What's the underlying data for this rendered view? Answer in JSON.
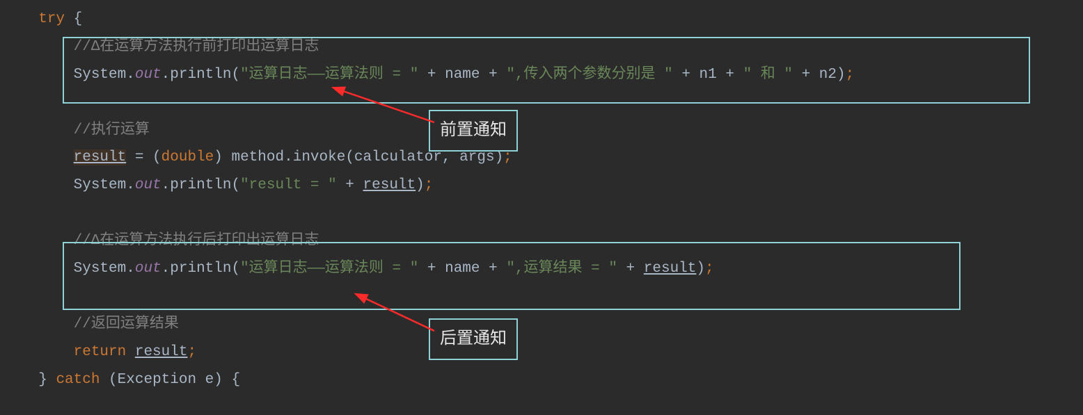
{
  "annotations": {
    "label1": "前置通知",
    "label2": "后置通知"
  },
  "code": {
    "l1_try": "try",
    "l1_brace": " {",
    "l2_comment": "//Δ在运算方法执行前打印出运算日志",
    "l3_sys": "System.",
    "l3_out": "out",
    "l3_println": ".println(",
    "l3_str1": "\"运算日志——运算法则 = \"",
    "l3_plus1": " + name + ",
    "l3_str2": "\",传入两个参数分别是 \"",
    "l3_plus2": " + n1 + ",
    "l3_str3": "\" 和 \"",
    "l3_plus3": " + n2)",
    "l3_semi": ";",
    "l5_comment": "//执行运算",
    "l6_result": "result",
    "l6_eq": " = (",
    "l6_cast": "double",
    "l6_invoke": ") method.invoke(calculator",
    "l6_args": ", args)",
    "l6_semi": ";",
    "l7_sys": "System.",
    "l7_out": "out",
    "l7_println": ".println(",
    "l7_str": "\"result = \"",
    "l7_plus": " + ",
    "l7_result": "result",
    "l7_close": ")",
    "l7_semi": ";",
    "l9_comment": "//Δ在运算方法执行后打印出运算日志",
    "l10_sys": "System.",
    "l10_out": "out",
    "l10_println": ".println(",
    "l10_str1": "\"运算日志——运算法则 = \"",
    "l10_plus1": " + name + ",
    "l10_str2": "\",运算结果 = \"",
    "l10_plus2": " + ",
    "l10_result": "result",
    "l10_close": ")",
    "l10_semi": ";",
    "l12_comment": "//返回运算结果",
    "l13_return": "return ",
    "l13_result": "result",
    "l13_semi": ";",
    "l14_brace": "} ",
    "l14_catch": "catch",
    "l14_paren": " (Exception e) {"
  }
}
